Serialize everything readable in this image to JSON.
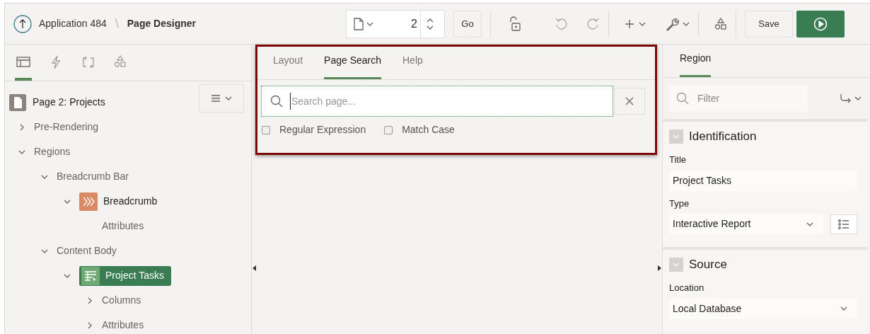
{
  "header": {
    "app": "Application 484",
    "separator": "\\",
    "page_title": "Page Designer"
  },
  "toolbar": {
    "page_number": "2",
    "go": "Go",
    "save": "Save"
  },
  "left_tabs": [
    {
      "kind": "rendering",
      "selected": true
    },
    {
      "kind": "dynamic",
      "selected": false
    },
    {
      "kind": "processing",
      "selected": false
    },
    {
      "kind": "shared",
      "selected": false
    }
  ],
  "tree": {
    "label": "Page 2: Projects",
    "children": [
      {
        "label": "Pre-Rendering",
        "expanded": false,
        "selected": false
      },
      {
        "label": "Regions",
        "expanded": true,
        "selected": false,
        "children": [
          {
            "label": "Breadcrumb Bar",
            "expanded": true,
            "selected": false,
            "children": [
              {
                "label": "Breadcrumb",
                "kind": "breadcrumb",
                "expanded": true,
                "selected": false,
                "children": [
                  {
                    "label": "Attributes",
                    "selected": false
                  }
                ]
              }
            ]
          },
          {
            "label": "Content Body",
            "expanded": true,
            "selected": false,
            "children": [
              {
                "label": "Project Tasks",
                "kind": "report",
                "expanded": true,
                "selected": true,
                "children": [
                  {
                    "label": "Columns",
                    "expanded": false,
                    "selected": false
                  },
                  {
                    "label": "Attributes",
                    "expanded": false,
                    "selected": false
                  }
                ]
              }
            ]
          }
        ]
      }
    ]
  },
  "center_tabs": [
    {
      "label": "Layout",
      "selected": false
    },
    {
      "label": "Page Search",
      "selected": true
    },
    {
      "label": "Help",
      "selected": false
    }
  ],
  "search": {
    "placeholder": "Search page..."
  },
  "options": [
    {
      "label": "Regular Expression",
      "checked": false
    },
    {
      "label": "Match Case",
      "checked": false
    }
  ],
  "right_tabs": [
    {
      "label": "Region",
      "selected": true
    }
  ],
  "filter": {
    "placeholder": "Filter"
  },
  "sections": [
    {
      "title": "Identification",
      "expanded": true,
      "fields": [
        {
          "label": "Title",
          "kind": "text",
          "value": "Project Tasks"
        },
        {
          "label": "Type",
          "kind": "select",
          "value": "Interactive Report",
          "list_button": true
        }
      ]
    },
    {
      "title": "Source",
      "expanded": true,
      "fields": [
        {
          "label": "Location",
          "kind": "select",
          "value": "Local Database"
        }
      ]
    }
  ]
}
